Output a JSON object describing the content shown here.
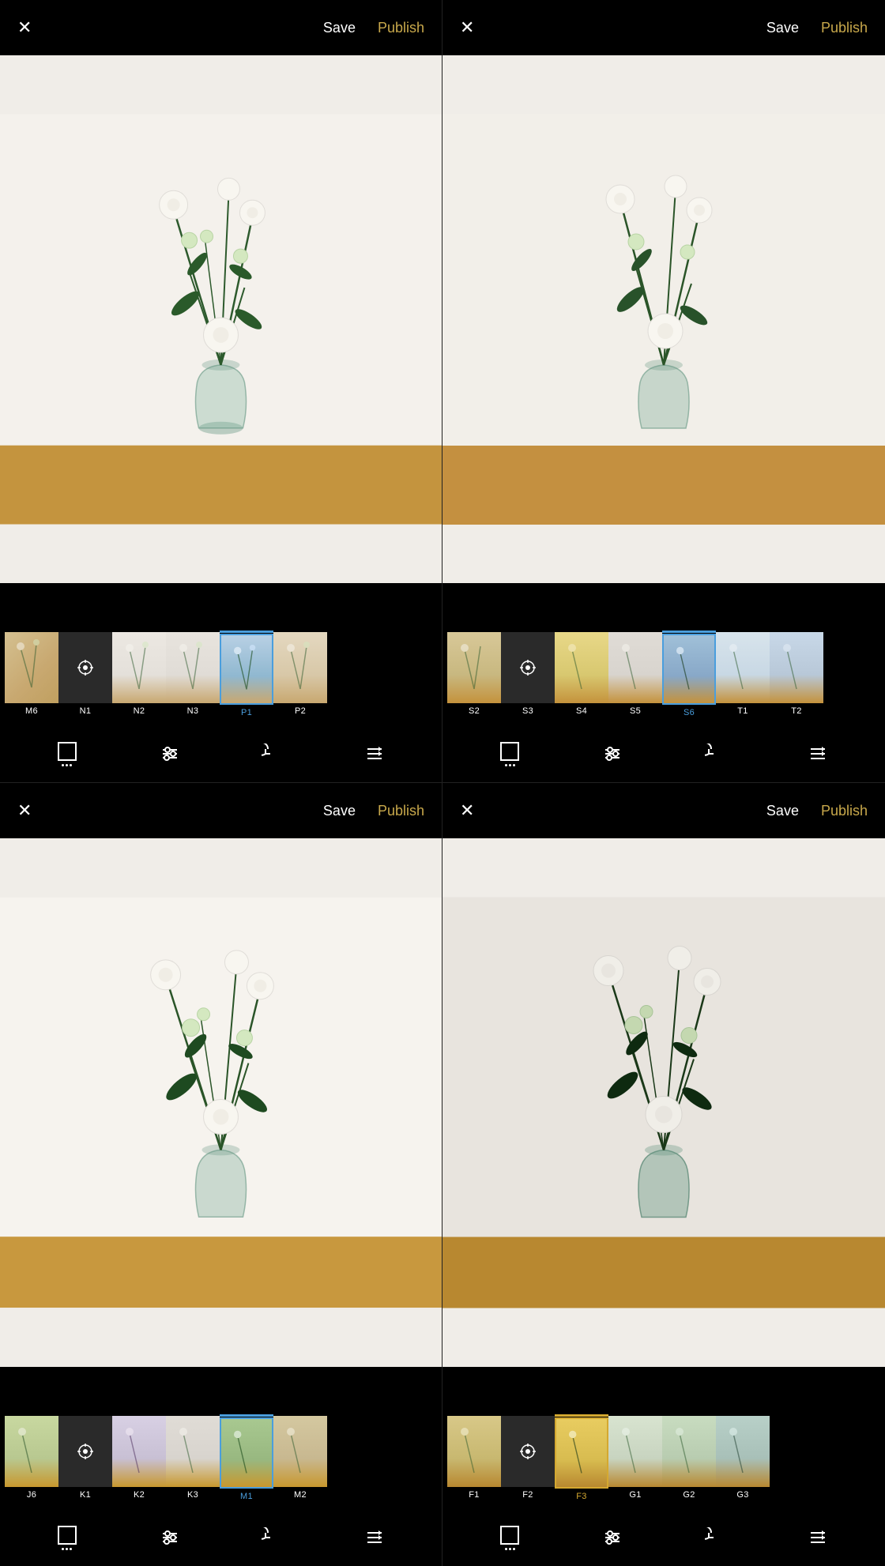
{
  "panels": [
    {
      "id": "panel-1",
      "topbar": {
        "save_label": "Save",
        "publish_label": "Publish"
      },
      "filters": {
        "items": [
          {
            "label": "M6",
            "active": false,
            "tint": "warm1"
          },
          {
            "label": "N1",
            "active": false,
            "tint": "center"
          },
          {
            "label": "N2",
            "active": false,
            "tint": "muted"
          },
          {
            "label": "N3",
            "active": false,
            "tint": "muted"
          },
          {
            "label": "P1",
            "active": true,
            "tint": "blue-active"
          },
          {
            "label": "P2",
            "active": false,
            "tint": "warm2"
          }
        ]
      }
    },
    {
      "id": "panel-2",
      "topbar": {
        "save_label": "Save",
        "publish_label": "Publish"
      },
      "filters": {
        "items": [
          {
            "label": "S2",
            "active": false,
            "tint": "warm1"
          },
          {
            "label": "S3",
            "active": false,
            "tint": "center"
          },
          {
            "label": "S4",
            "active": false,
            "tint": "yellow"
          },
          {
            "label": "S5",
            "active": false,
            "tint": "muted"
          },
          {
            "label": "S6",
            "active": true,
            "tint": "blue-active"
          },
          {
            "label": "T1",
            "active": false,
            "tint": "cool1"
          },
          {
            "label": "T2",
            "active": false,
            "tint": "cool2"
          }
        ]
      }
    },
    {
      "id": "panel-3",
      "topbar": {
        "save_label": "Save",
        "publish_label": "Publish"
      },
      "filters": {
        "items": [
          {
            "label": "J6",
            "active": false,
            "tint": "green1"
          },
          {
            "label": "K1",
            "active": false,
            "tint": "center"
          },
          {
            "label": "K2",
            "active": false,
            "tint": "purple"
          },
          {
            "label": "K3",
            "active": false,
            "tint": "muted"
          },
          {
            "label": "M1",
            "active": true,
            "tint": "green2"
          },
          {
            "label": "M2",
            "active": false,
            "tint": "warm1"
          }
        ]
      }
    },
    {
      "id": "panel-4",
      "topbar": {
        "save_label": "Save",
        "publish_label": "Publish"
      },
      "filters": {
        "items": [
          {
            "label": "F1",
            "active": false,
            "tint": "warm1"
          },
          {
            "label": "F2",
            "active": false,
            "tint": "center"
          },
          {
            "label": "F3",
            "active": true,
            "tint": "yellow-active"
          },
          {
            "label": "G1",
            "active": false,
            "tint": "cool1"
          },
          {
            "label": "G2",
            "active": false,
            "tint": "green2"
          },
          {
            "label": "G3",
            "active": false,
            "tint": "cool2"
          }
        ]
      }
    }
  ],
  "toolbar": {
    "frame_icon": "⬜",
    "adjust_icon": "⚙",
    "history_icon": "↺",
    "preset_icon": "≡"
  }
}
